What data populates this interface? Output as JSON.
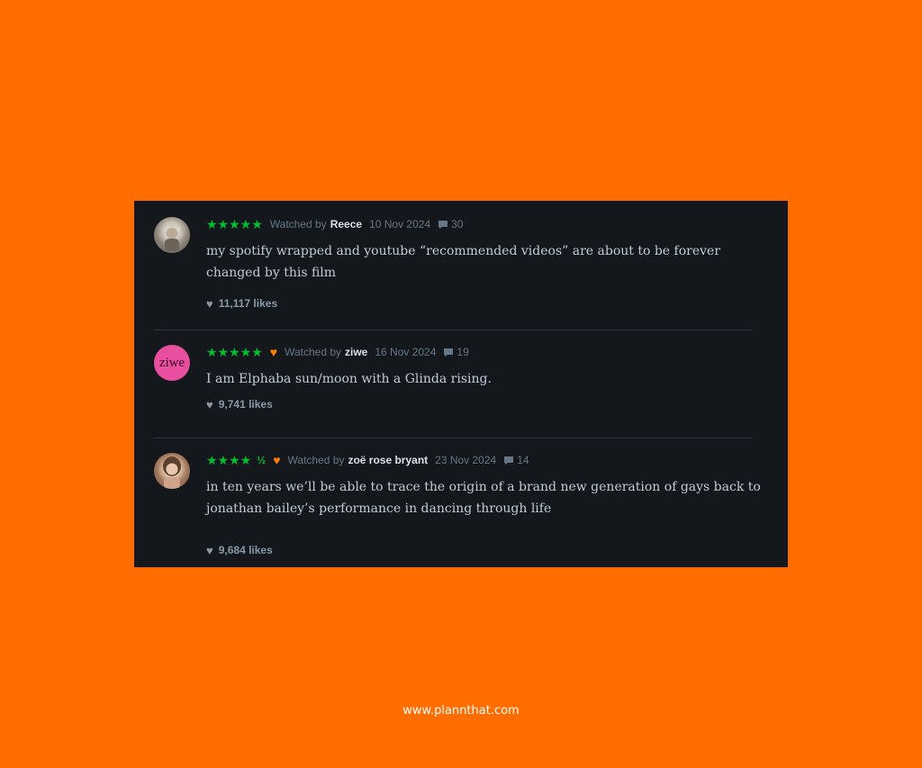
{
  "reviews": [
    {
      "stars": "★★★★★",
      "half": "",
      "liked": false,
      "watched_label": "Watched by",
      "user": "Reece",
      "date": "10 Nov 2024",
      "comments": "30",
      "text": "my spotify wrapped and youtube “recommended videos” are about to be forever changed by this film",
      "likes": "11,117 likes"
    },
    {
      "stars": "★★★★★",
      "half": "",
      "liked": true,
      "watched_label": "Watched by",
      "user": "ziwe",
      "avatar_text": "ziwe",
      "date": "16 Nov 2024",
      "comments": "19",
      "text": "I am Elphaba sun/moon with a Glinda rising.",
      "likes": "9,741 likes"
    },
    {
      "stars": "★★★★",
      "half": "½",
      "liked": true,
      "watched_label": "Watched by",
      "user": "zoë rose bryant",
      "date": "23 Nov 2024",
      "comments": "14",
      "text": "in ten years we’ll be able to trace the origin of a brand new generation of gays back to jonathan bailey’s performance in dancing through life",
      "likes": "9,684 likes"
    }
  ],
  "footer": "www.plannthat.com",
  "colors": {
    "background": "#ff6d00",
    "card": "#14181c",
    "star": "#00c030",
    "like_heart": "#ff8000"
  }
}
